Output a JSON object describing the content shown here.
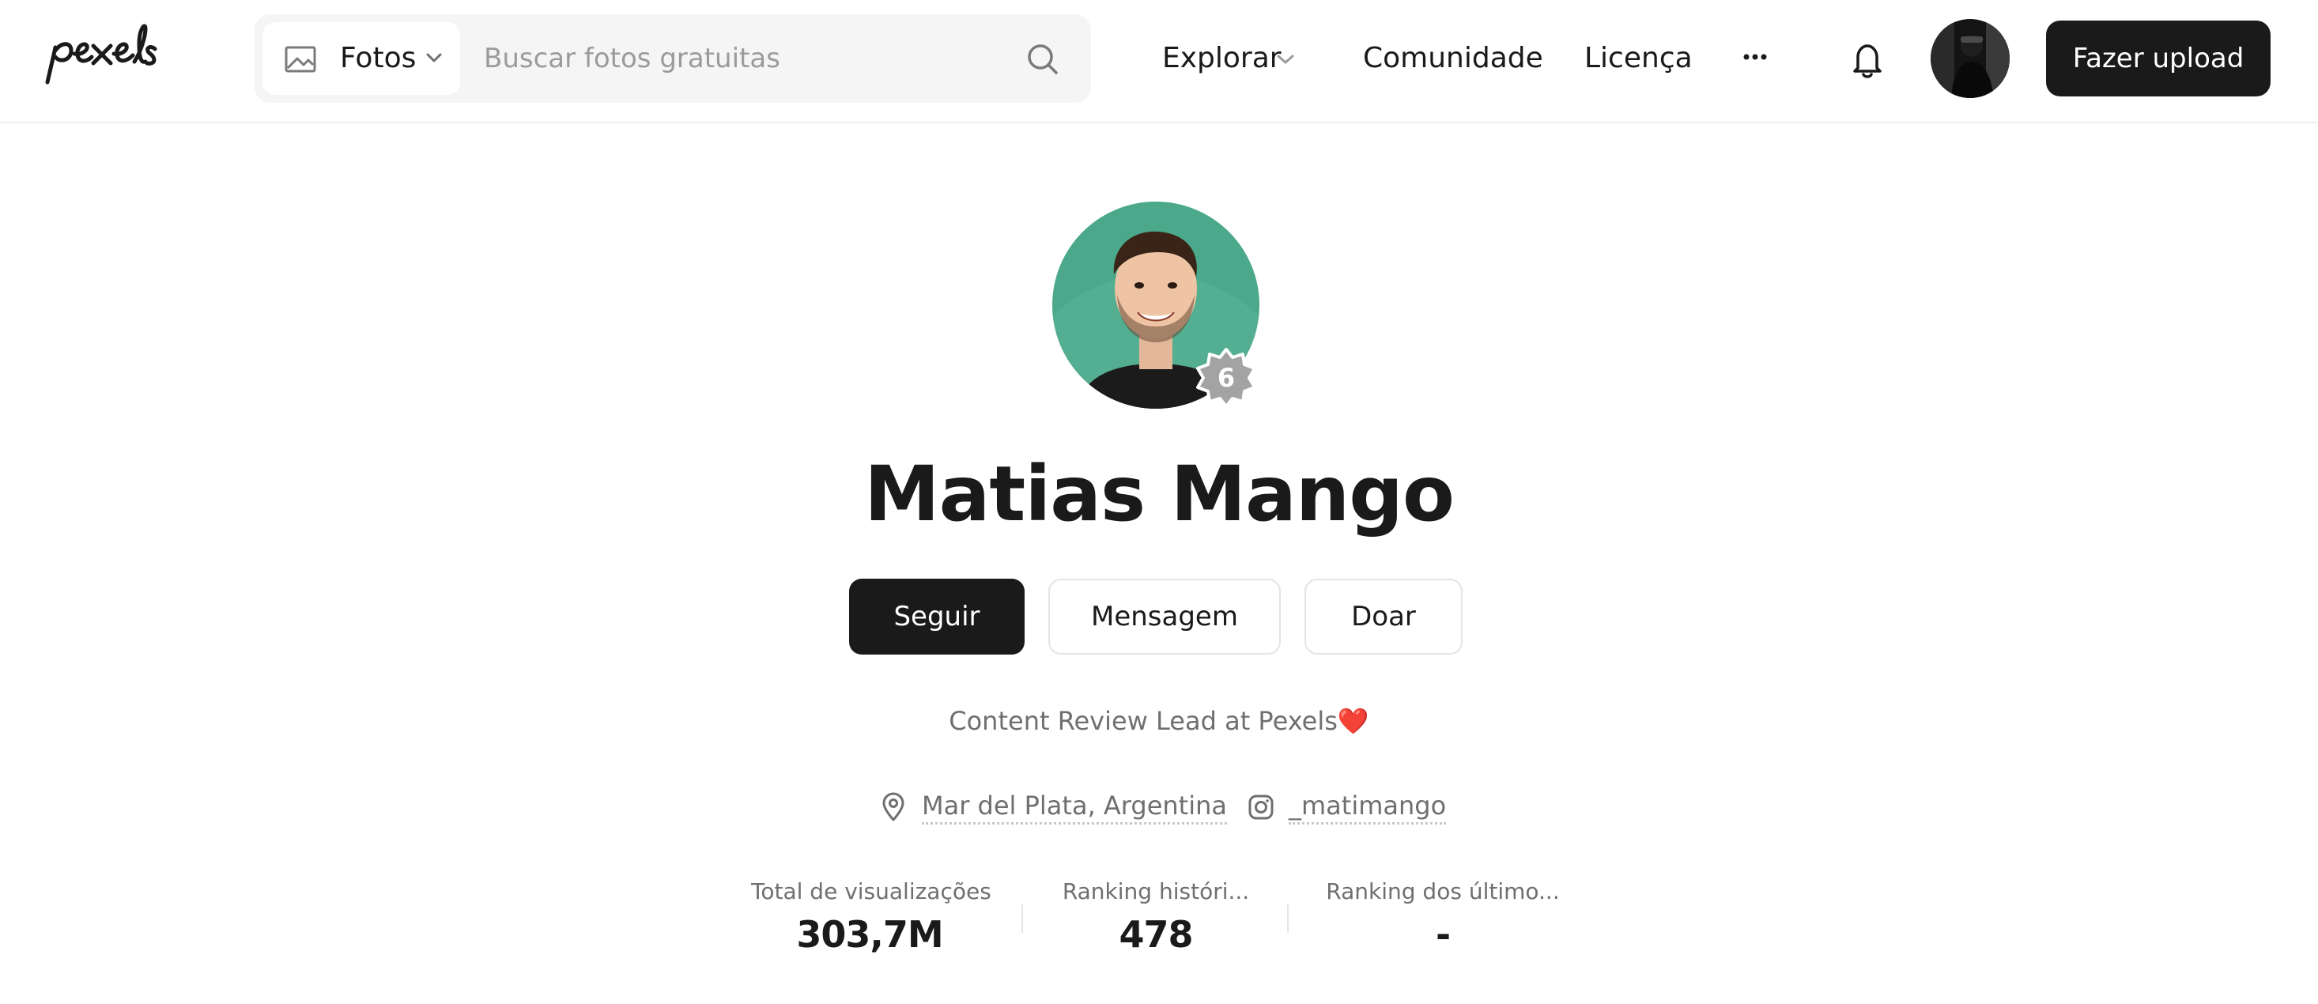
{
  "header": {
    "logo_text": "pexels",
    "search": {
      "type_label": "Fotos",
      "placeholder": "Buscar fotos gratuitas"
    },
    "nav": {
      "explore": "Explorar",
      "community": "Comunidade",
      "license": "Licença"
    },
    "upload_label": "Fazer upload"
  },
  "profile": {
    "name": "Matias Mango",
    "level": "6",
    "buttons": {
      "follow": "Seguir",
      "message": "Mensagem",
      "donate": "Doar"
    },
    "bio": "Content Review Lead at Pexels",
    "bio_emoji": "❤️",
    "location": "Mar del Plata, Argentina",
    "instagram": "_matimango"
  },
  "stats": [
    {
      "label": "Total de visualizações",
      "value": "303,7M"
    },
    {
      "label": "Ranking históri...",
      "value": "478"
    },
    {
      "label": "Ranking dos último...",
      "value": "-"
    }
  ],
  "colors": {
    "primary_dark": "#1a1a1a",
    "avatar_bg": "#4ca88a",
    "badge": "#a3a3a3",
    "heart": "#e0322f"
  }
}
